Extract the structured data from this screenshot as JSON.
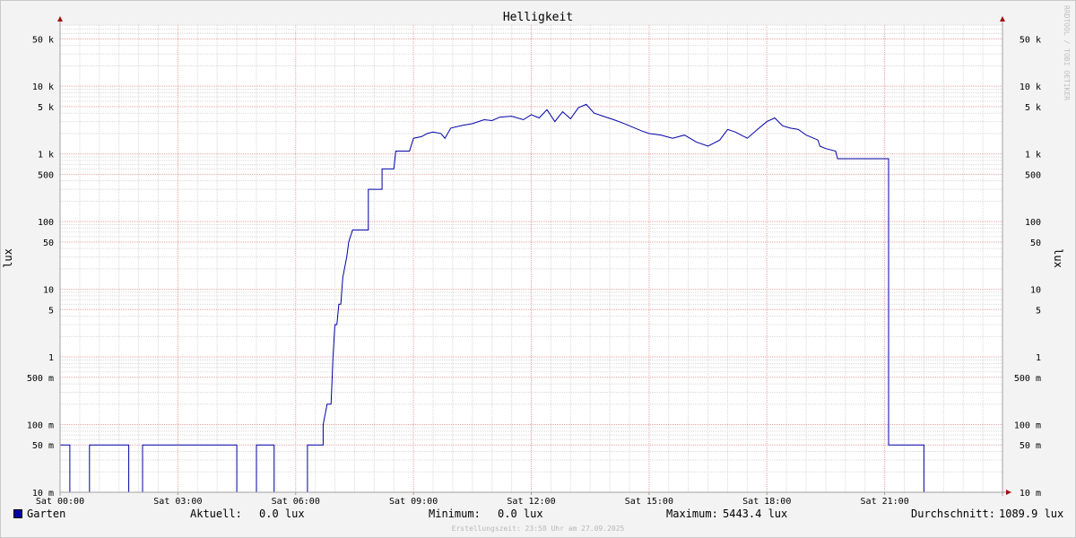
{
  "chart_data": {
    "type": "line",
    "title": "Helligkeit",
    "ylabel": "lux",
    "y_scale": "log",
    "ylim": [
      10,
      80000
    ],
    "xlim": [
      "Sat 00:00",
      "Sat 24:00"
    ],
    "x_unit": "hours",
    "x_range_hours": [
      0,
      24
    ],
    "watermark": "RRDTOOL / TOBI OETIKER",
    "x_ticks": [
      {
        "h": 0,
        "label": "Sat 00:00"
      },
      {
        "h": 3,
        "label": "Sat 03:00"
      },
      {
        "h": 6,
        "label": "Sat 06:00"
      },
      {
        "h": 9,
        "label": "Sat 09:00"
      },
      {
        "h": 12,
        "label": "Sat 12:00"
      },
      {
        "h": 15,
        "label": "Sat 15:00"
      },
      {
        "h": 18,
        "label": "Sat 18:00"
      },
      {
        "h": 21,
        "label": "Sat 21:00"
      }
    ],
    "y_ticks": [
      {
        "v": 10,
        "label": "10 m"
      },
      {
        "v": 50,
        "label": "50 m"
      },
      {
        "v": 100,
        "label": "100 m"
      },
      {
        "v": 500,
        "label": "500 m"
      },
      {
        "v": 1000,
        "label": "1"
      },
      {
        "v": 5000,
        "label": "5"
      },
      {
        "v": 10000,
        "label": "10"
      },
      {
        "v": 50000,
        "label": "50"
      },
      {
        "v": 100000,
        "label": "100"
      },
      {
        "v": 500000,
        "label": "500"
      },
      {
        "v": 1000000,
        "label": "1 k"
      },
      {
        "v": 5000000,
        "label": "5 k"
      },
      {
        "v": 10000000,
        "label": "10 k"
      },
      {
        "v": 50000000,
        "label": "50 k"
      }
    ],
    "y_unit_note": "values in millilux (m) scale mapped 1:1 to tick positions",
    "series": [
      {
        "name": "Garten",
        "color": "#0000a8",
        "points": [
          [
            0.0,
            50
          ],
          [
            0.25,
            50
          ],
          [
            0.25,
            10
          ],
          [
            0.75,
            10
          ],
          [
            0.75,
            50
          ],
          [
            1.75,
            50
          ],
          [
            1.75,
            10
          ],
          [
            2.1,
            10
          ],
          [
            2.1,
            50
          ],
          [
            4.5,
            50
          ],
          [
            4.5,
            10
          ],
          [
            5.0,
            10
          ],
          [
            5.0,
            50
          ],
          [
            5.45,
            50
          ],
          [
            5.45,
            10
          ],
          [
            6.3,
            10
          ],
          [
            6.3,
            50
          ],
          [
            6.7,
            50
          ],
          [
            6.7,
            100
          ],
          [
            6.8,
            200
          ],
          [
            6.9,
            200
          ],
          [
            6.95,
            1000
          ],
          [
            7.0,
            3000
          ],
          [
            7.05,
            3000
          ],
          [
            7.1,
            6000
          ],
          [
            7.15,
            6000
          ],
          [
            7.2,
            15000
          ],
          [
            7.3,
            30000
          ],
          [
            7.35,
            50000
          ],
          [
            7.45,
            75000
          ],
          [
            7.85,
            75000
          ],
          [
            7.85,
            300000
          ],
          [
            8.2,
            300000
          ],
          [
            8.2,
            600000
          ],
          [
            8.5,
            600000
          ],
          [
            8.55,
            1100000
          ],
          [
            8.9,
            1100000
          ],
          [
            9.0,
            1700000
          ],
          [
            9.2,
            1800000
          ],
          [
            9.35,
            2000000
          ],
          [
            9.5,
            2100000
          ],
          [
            9.7,
            2000000
          ],
          [
            9.8,
            1700000
          ],
          [
            9.95,
            2400000
          ],
          [
            10.2,
            2600000
          ],
          [
            10.5,
            2800000
          ],
          [
            10.8,
            3200000
          ],
          [
            11.0,
            3100000
          ],
          [
            11.2,
            3500000
          ],
          [
            11.5,
            3600000
          ],
          [
            11.8,
            3200000
          ],
          [
            12.0,
            3800000
          ],
          [
            12.2,
            3400000
          ],
          [
            12.4,
            4500000
          ],
          [
            12.6,
            3000000
          ],
          [
            12.8,
            4200000
          ],
          [
            13.0,
            3300000
          ],
          [
            13.2,
            4800000
          ],
          [
            13.4,
            5400000
          ],
          [
            13.6,
            4000000
          ],
          [
            13.9,
            3500000
          ],
          [
            14.1,
            3200000
          ],
          [
            14.3,
            2900000
          ],
          [
            14.5,
            2600000
          ],
          [
            14.8,
            2200000
          ],
          [
            15.0,
            2000000
          ],
          [
            15.3,
            1900000
          ],
          [
            15.6,
            1700000
          ],
          [
            15.9,
            1900000
          ],
          [
            16.2,
            1500000
          ],
          [
            16.5,
            1300000
          ],
          [
            16.8,
            1600000
          ],
          [
            17.0,
            2300000
          ],
          [
            17.2,
            2100000
          ],
          [
            17.5,
            1700000
          ],
          [
            17.8,
            2400000
          ],
          [
            18.0,
            3000000
          ],
          [
            18.2,
            3400000
          ],
          [
            18.4,
            2600000
          ],
          [
            18.6,
            2400000
          ],
          [
            18.8,
            2300000
          ],
          [
            19.0,
            1900000
          ],
          [
            19.3,
            1600000
          ],
          [
            19.35,
            1300000
          ],
          [
            19.5,
            1200000
          ],
          [
            19.75,
            1100000
          ],
          [
            19.8,
            850000
          ],
          [
            20.2,
            850000
          ],
          [
            20.9,
            850000
          ],
          [
            21.1,
            850000
          ],
          [
            21.1,
            50
          ],
          [
            21.5,
            50
          ],
          [
            22.0,
            50
          ],
          [
            22.0,
            10
          ],
          [
            22.5,
            10
          ],
          [
            24.0,
            10
          ]
        ]
      }
    ]
  },
  "legend": {
    "series_name": "Garten",
    "aktuell_label": "Aktuell:",
    "aktuell_value": "0.0 lux",
    "minimum_label": "Minimum:",
    "minimum_value": "0.0 lux",
    "maximum_label": "Maximum:",
    "maximum_value": "5443.4 lux",
    "durchschnitt_label": "Durchschnitt:",
    "durchschnitt_value": "1089.9 lux"
  },
  "footer": "Erstellungszeit: 23:58 Uhr am 27.09.2025",
  "colors": {
    "line": "#0000a8",
    "grid_major": "#e6a0a0",
    "grid_minor": "#d8d8d8",
    "axis": "#a0a0a0",
    "arrow": "#a01010"
  }
}
